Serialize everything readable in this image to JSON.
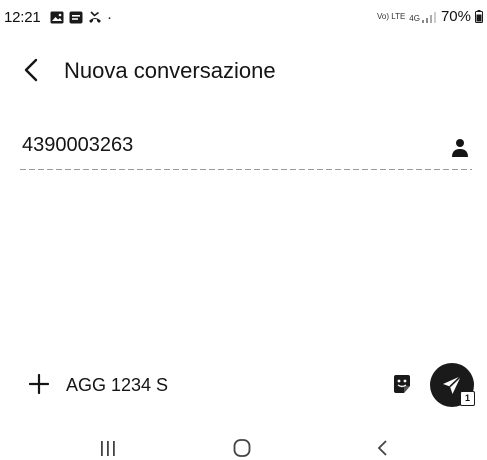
{
  "status_bar": {
    "time": "12:21",
    "notification_icons": [
      "gallery-icon",
      "message-icon",
      "missed-call-icon"
    ],
    "dot": "·",
    "network_label": "Vo) LTE",
    "signal_label": "4G",
    "battery": "70%"
  },
  "app_bar": {
    "title": "Nuova conversazione"
  },
  "recipient": {
    "value": "4390003263"
  },
  "composer": {
    "message_value": "AGG 1234 S",
    "sim_label": "1"
  },
  "colors": {
    "background": "#ffffff",
    "text": "#151515",
    "send_button": "#1a1a1a"
  }
}
